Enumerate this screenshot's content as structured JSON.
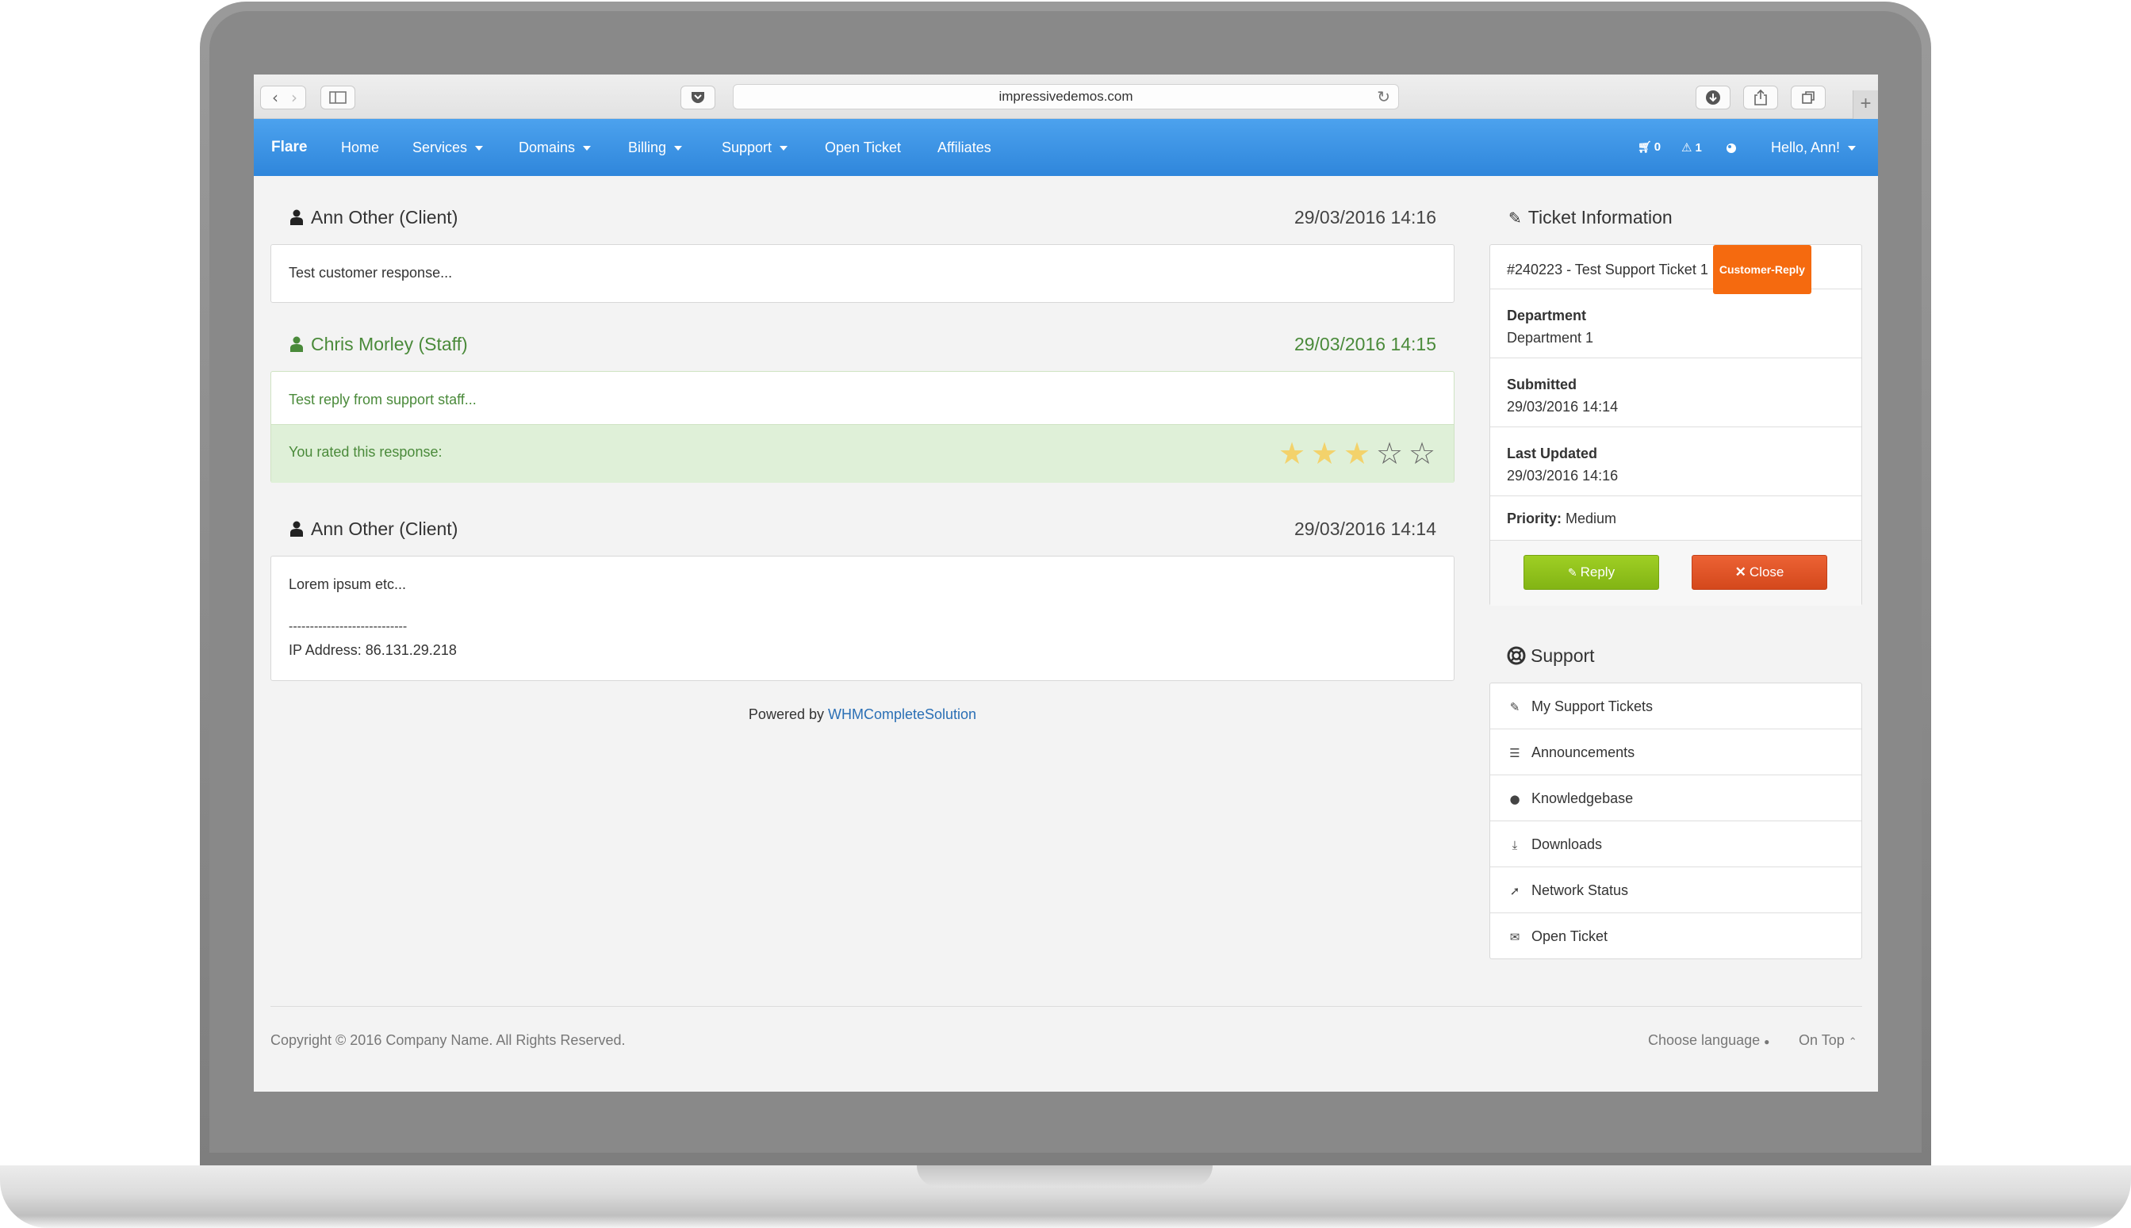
{
  "browser": {
    "url": "impressivedemos.com",
    "back_icon": "‹",
    "forward_icon": "›"
  },
  "nav": {
    "brand": "Flare",
    "items": [
      "Home",
      "Services",
      "Domains",
      "Billing",
      "Support",
      "Open Ticket",
      "Affiliates"
    ],
    "cart_count": "0",
    "alerts_count": "1",
    "user_menu": "Hello, Ann!"
  },
  "posts": [
    {
      "author": "Ann Other (Client)",
      "date": "29/03/2016 14:16",
      "body": "Test customer response..."
    },
    {
      "author": "Chris Morley (Staff)",
      "date": "29/03/2016 14:15",
      "body": "Test reply from support staff...",
      "rating_label": "You rated this response:",
      "rating": 3,
      "rating_max": 5
    },
    {
      "author": "Ann Other (Client)",
      "date": "29/03/2016 14:14",
      "body": "Lorem ipsum etc...",
      "separator": "----------------------------",
      "ip": "IP Address: 86.131.29.218"
    }
  ],
  "powered_by": {
    "prefix": "Powered by ",
    "link": "WHMCompleteSolution"
  },
  "ticket_info": {
    "heading": "Ticket Information",
    "title": "#240223 - Test Support Ticket 1",
    "status": "Customer-Reply",
    "department_label": "Department",
    "department": "Department 1",
    "submitted_label": "Submitted",
    "submitted": "29/03/2016 14:14",
    "updated_label": "Last Updated",
    "updated": "29/03/2016 14:16",
    "priority_label": "Priority:",
    "priority": "Medium",
    "reply_button": "Reply",
    "close_button": "Close"
  },
  "support_menu": {
    "heading": "Support",
    "items": [
      "My Support Tickets",
      "Announcements",
      "Knowledgebase",
      "Downloads",
      "Network Status",
      "Open Ticket"
    ]
  },
  "footer": {
    "copyright": "Copyright © 2016 Company Name. All Rights Reserved.",
    "language": "Choose language",
    "on_top": "On Top"
  },
  "colors": {
    "nav": "#3a94e6",
    "staff": "#4a8a3a",
    "rating_bg": "#dff0d8",
    "star": "#f3d26b",
    "reply_button": "#8fbf1b",
    "close_button": "#e25526",
    "badge": "#f56a0f"
  }
}
